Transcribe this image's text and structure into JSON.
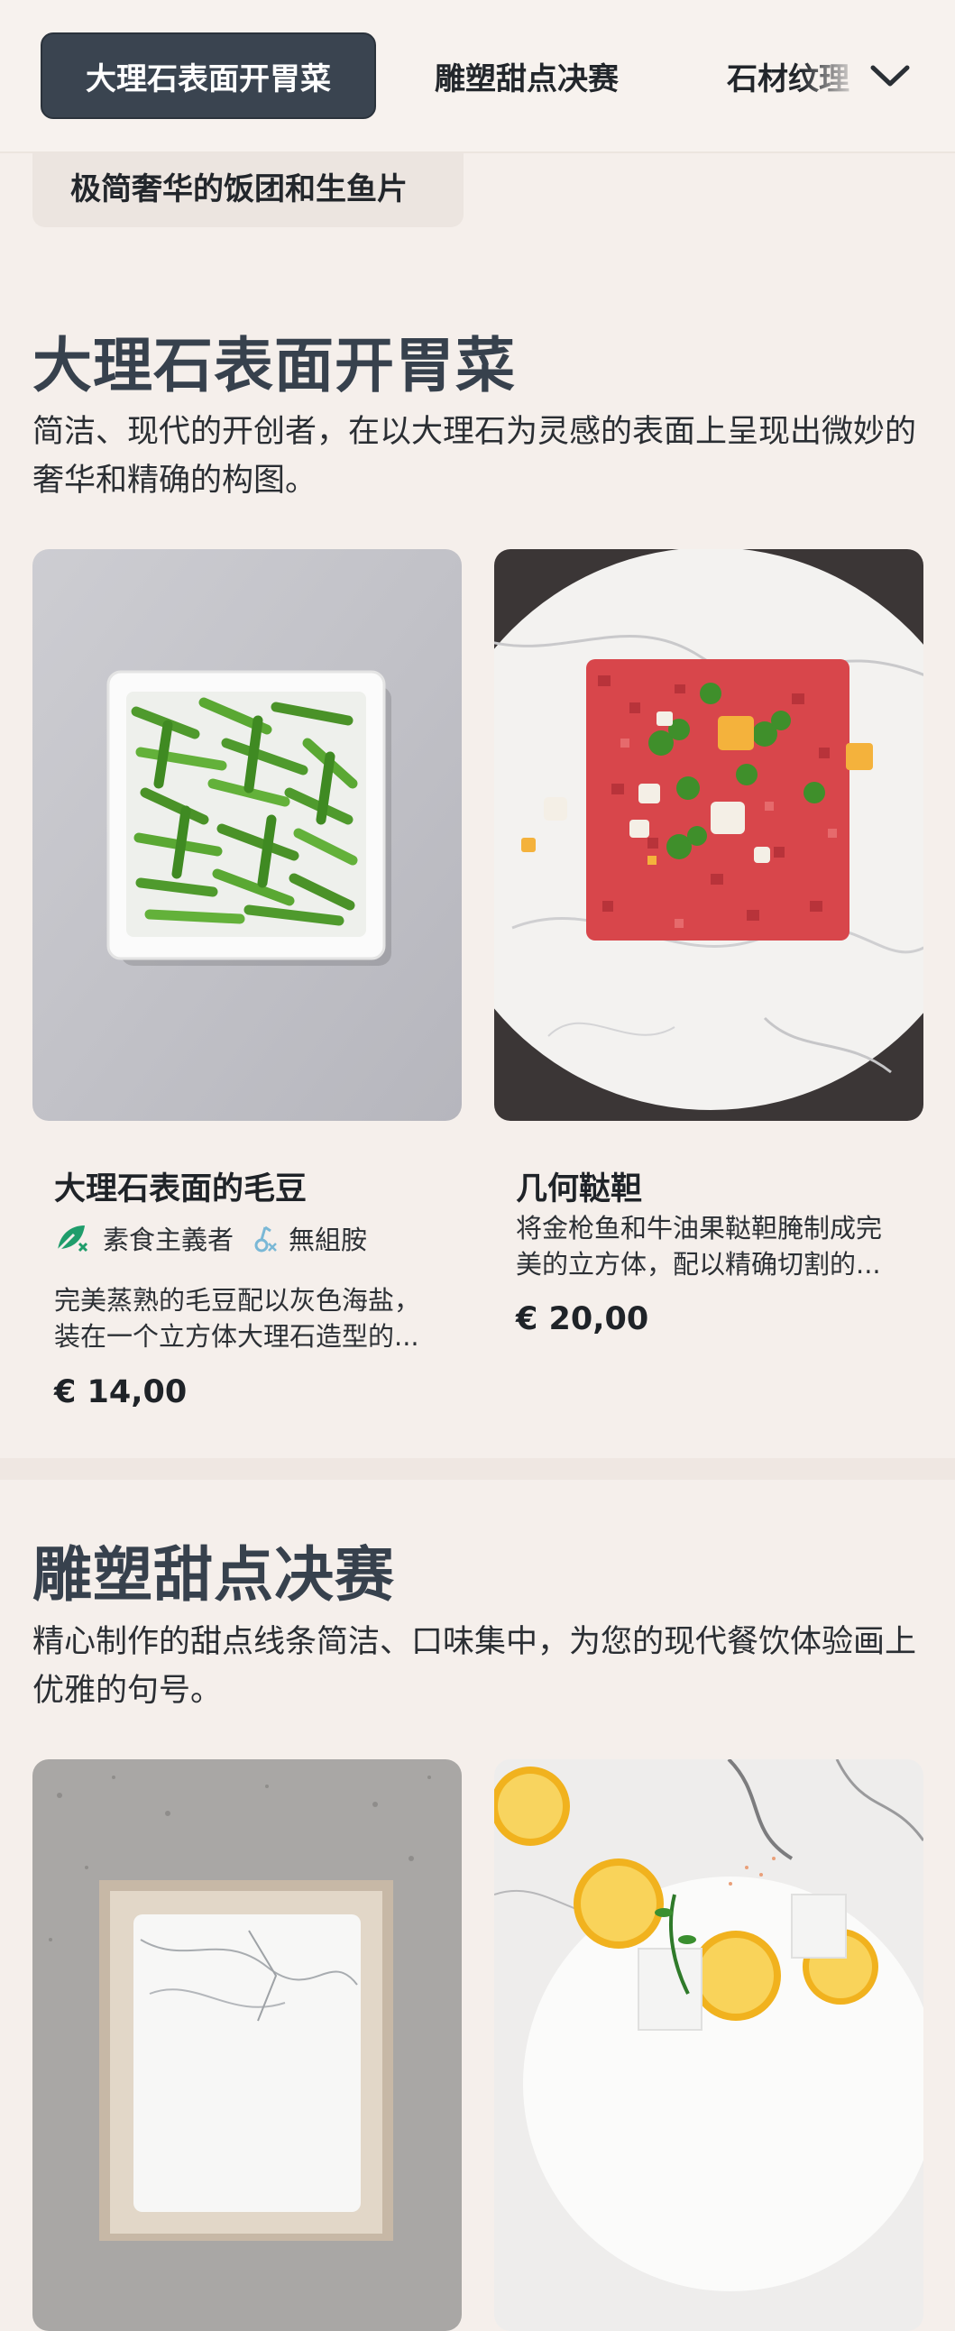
{
  "nav": {
    "tabs": [
      {
        "label": "大理石表面开胃菜",
        "active": true
      },
      {
        "label": "雕塑甜点决赛",
        "active": false
      },
      {
        "label": "石材纹理",
        "active": false
      }
    ],
    "expand_icon": "chevron-down-icon"
  },
  "subcategory_chip": "极简奢华的饭团和生鱼片",
  "sections": [
    {
      "title": "大理石表面开胃菜",
      "description": "简洁、现代的开创者，在以大理石为灵感的表面上呈现出微妙的奢华和精确的构图。",
      "items": [
        {
          "name": "大理石表面的毛豆",
          "tags": [
            {
              "label": "素食主義者",
              "icon": "vegan-leaf-icon",
              "color": "#1f9d6b"
            },
            {
              "label": "無組胺",
              "icon": "histamine-free-icon",
              "color": "#7ab8d6"
            }
          ],
          "description": "完美蒸熟的毛豆配以灰色海盐，装在一个立方体大理石造型的...",
          "price": "€ 14,00"
        },
        {
          "name": "几何鞑靼",
          "tags": [],
          "description": "将金枪鱼和牛油果鞑靼腌制成完美的立方体，配以精确切割的...",
          "price": "€ 20,00"
        }
      ]
    },
    {
      "title": "雕塑甜点决赛",
      "description": "精心制作的甜点线条简洁、口味集中，为您的现代餐饮体验画上优雅的句号。",
      "items": []
    }
  ]
}
